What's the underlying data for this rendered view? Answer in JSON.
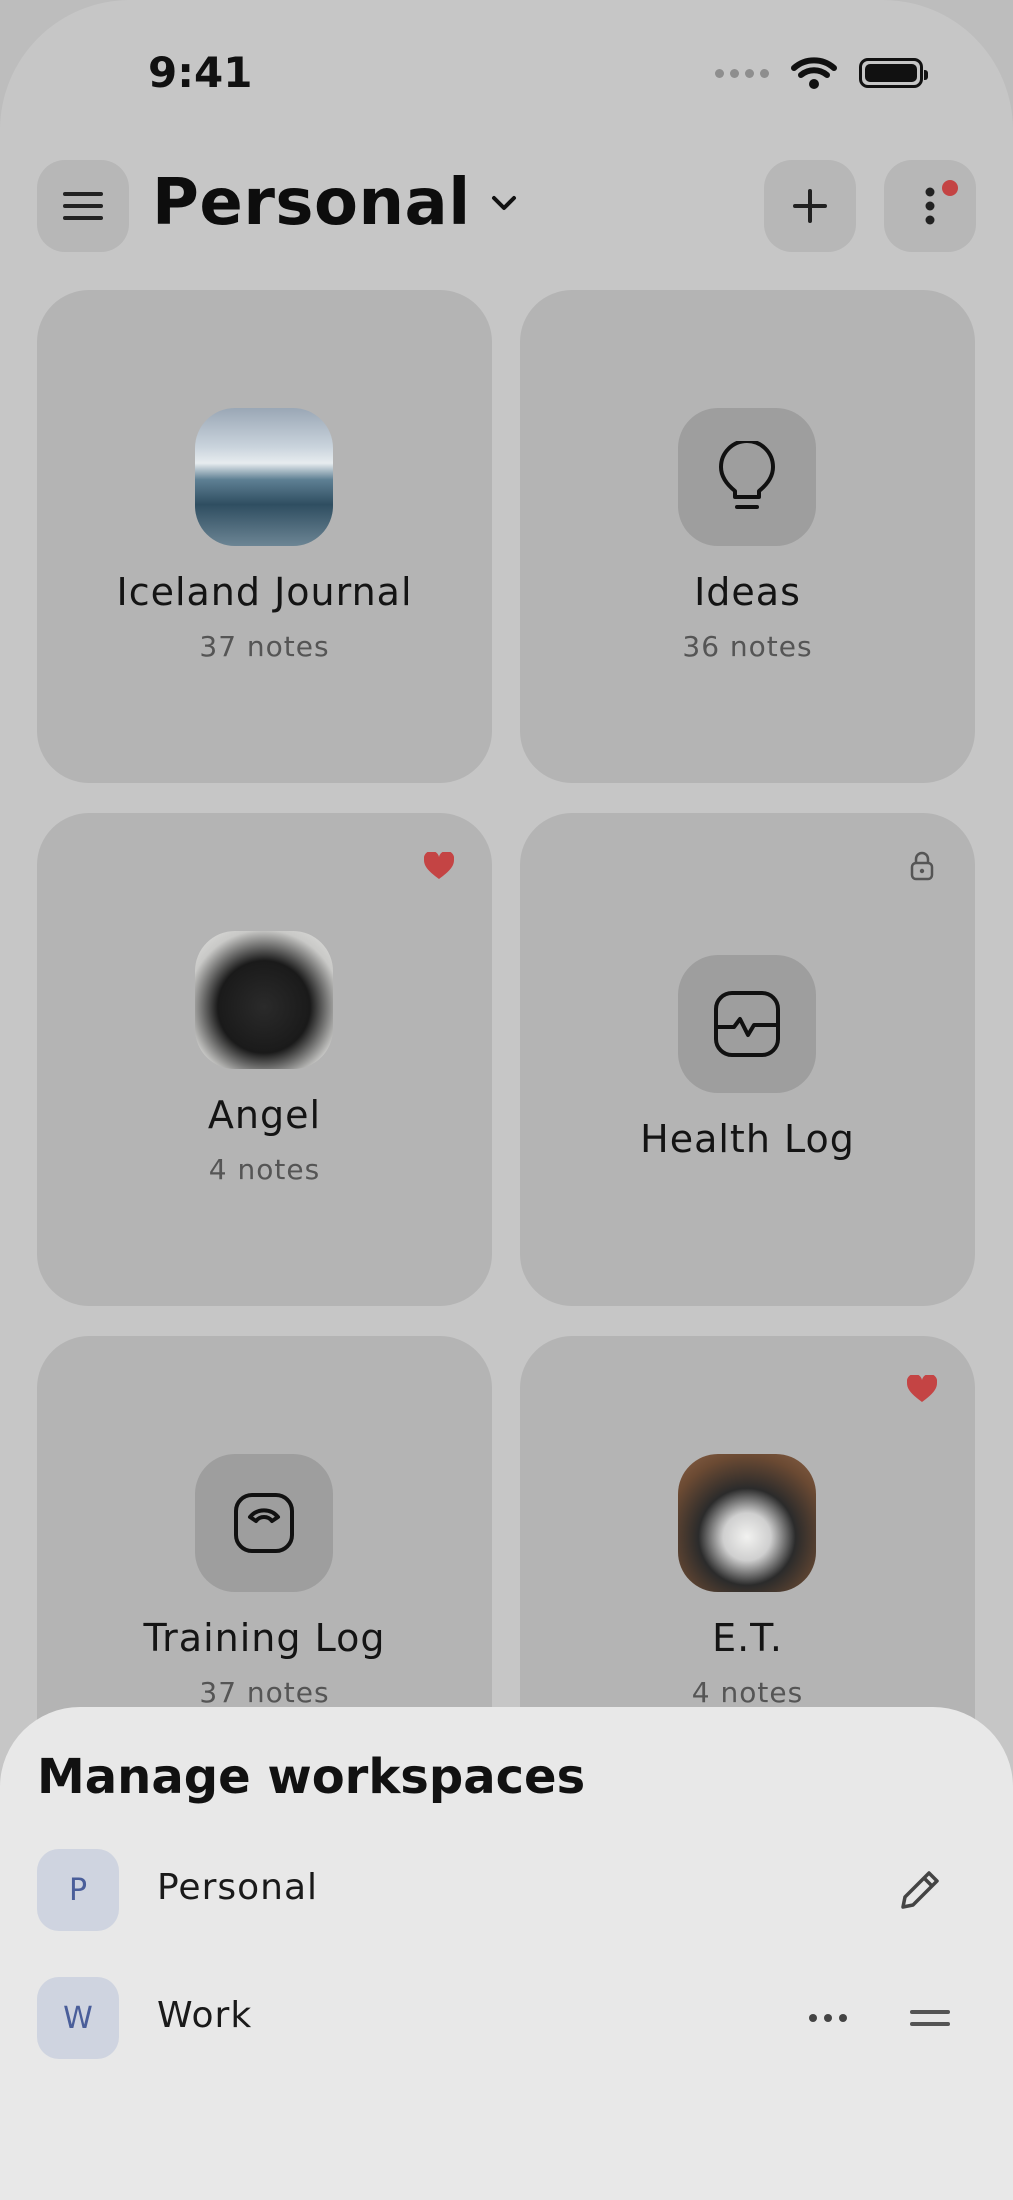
{
  "status_bar": {
    "time": "9:41"
  },
  "header": {
    "workspace_title": "Personal"
  },
  "notebooks": [
    {
      "title": "Iceland Journal",
      "subtitle": "37 notes",
      "icon": "photo-iceland",
      "badge": null
    },
    {
      "title": "Ideas",
      "subtitle": "36 notes",
      "icon": "lightbulb-icon",
      "badge": null
    },
    {
      "title": "Angel",
      "subtitle": "4 notes",
      "icon": "photo-cat",
      "badge": "heart-icon"
    },
    {
      "title": "Health Log",
      "subtitle": "",
      "icon": "activity-icon",
      "badge": "lock-icon"
    },
    {
      "title": "Training Log",
      "subtitle": "37 notes",
      "icon": "scale-icon",
      "badge": null
    },
    {
      "title": "E.T.",
      "subtitle": "4 notes",
      "icon": "photo-cat",
      "badge": "heart-icon"
    }
  ],
  "sheet": {
    "title": "Manage workspaces",
    "workspaces": [
      {
        "initial": "P",
        "name": "Personal",
        "action": "edit-icon"
      },
      {
        "initial": "W",
        "name": "Work",
        "action": "more-horizontal-icon"
      }
    ]
  },
  "colors": {
    "favorite": "#c44444",
    "avatar_bg": "#cfd4e0",
    "avatar_text": "#4a5e9a",
    "notification": "#c44444"
  }
}
